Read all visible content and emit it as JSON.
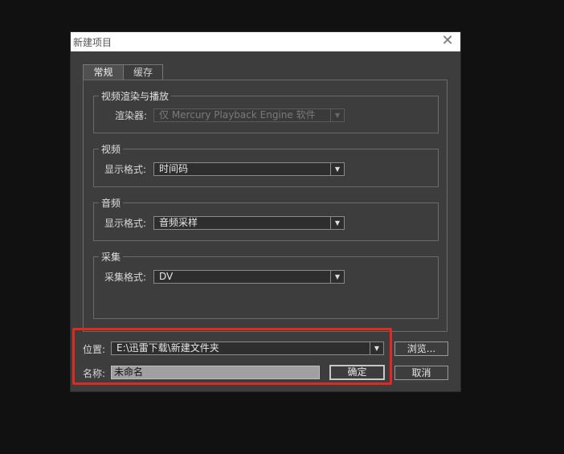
{
  "dialog": {
    "title": "新建项目",
    "close_glyph": "✕"
  },
  "tabs": [
    {
      "label": "常规",
      "active": true
    },
    {
      "label": "缓存",
      "active": false
    }
  ],
  "groups": {
    "render": {
      "title": "视频渲染与播放",
      "field_label": "渲染器:",
      "value": "仅 Mercury Playback Engine 软件",
      "disabled": true
    },
    "video": {
      "title": "视频",
      "field_label": "显示格式:",
      "value": "时间码"
    },
    "audio": {
      "title": "音频",
      "field_label": "显示格式:",
      "value": "音频采样"
    },
    "capture": {
      "title": "采集",
      "field_label": "采集格式:",
      "value": "DV"
    }
  },
  "location": {
    "label": "位置:",
    "value": "E:\\迅雷下载\\新建文件夹",
    "browse_label": "浏览..."
  },
  "name": {
    "label": "名称:",
    "value": "未命名"
  },
  "buttons": {
    "ok_label": "确定",
    "cancel_label": "取消"
  },
  "colors": {
    "highlight": "#e2281f",
    "dialog_bg": "#3d3d3d",
    "screen_bg": "#111111"
  },
  "icons": {
    "dropdown": "chevron-down-icon",
    "close": "close-icon"
  }
}
